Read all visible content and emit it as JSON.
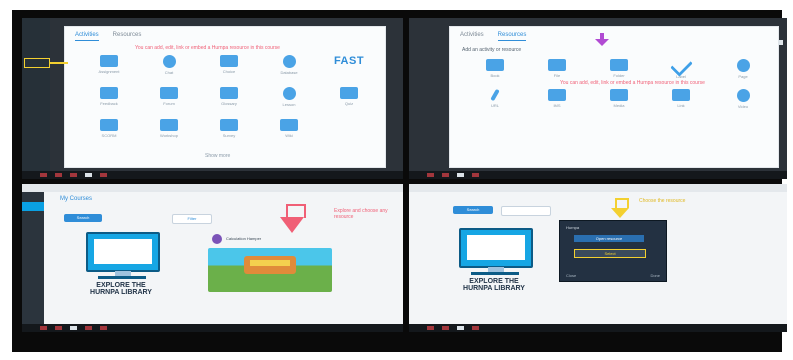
{
  "colors": {
    "accent_blue": "#2f8dd8",
    "hint_pink": "#f05f76",
    "highlight_yellow": "#f3d030",
    "dark_sidebar": "#263038",
    "taskbar_red": "#a2363c"
  },
  "screen1": {
    "tabs": [
      "Activities",
      "Resources"
    ],
    "hint": "You can add, edit, link or embed a Hurnpa resource in this course",
    "tiles": [
      {
        "label": "Assignment",
        "icon": "assignment-icon"
      },
      {
        "label": "Chat",
        "icon": "chat-icon"
      },
      {
        "label": "Choice",
        "icon": "choice-icon"
      },
      {
        "label": "Database",
        "icon": "database-icon"
      },
      {
        "label": "FAST",
        "icon": "fast-logo"
      },
      {
        "label": "Feedback",
        "icon": "feedback-icon"
      },
      {
        "label": "Forum",
        "icon": "forum-icon"
      },
      {
        "label": "Glossary",
        "icon": "glossary-icon"
      },
      {
        "label": "Lesson",
        "icon": "lesson-icon"
      },
      {
        "label": "Quiz",
        "icon": "quiz-icon"
      },
      {
        "label": "SCORM",
        "icon": "scorm-icon"
      },
      {
        "label": "Workshop",
        "icon": "workshop-icon"
      },
      {
        "label": "Survey",
        "icon": "survey-icon"
      },
      {
        "label": "Wiki",
        "icon": "wiki-icon"
      }
    ],
    "footer_link": "Show more"
  },
  "screen2": {
    "tabs": [
      "Activities",
      "Resources"
    ],
    "heading": "Add an activity or resource",
    "hint": "You can add, edit, link or embed a Hurnpa resource in this course",
    "row1": [
      {
        "label": "Book",
        "icon": "book-icon"
      },
      {
        "label": "File",
        "icon": "file-icon"
      },
      {
        "label": "Folder",
        "icon": "folder-icon"
      },
      {
        "label": "Label",
        "icon": "label-check-icon"
      },
      {
        "label": "Page",
        "icon": "page-icon"
      }
    ],
    "row2": [
      {
        "label": "URL",
        "icon": "url-icon"
      },
      {
        "label": "IMS",
        "icon": "ims-icon"
      },
      {
        "label": "Media",
        "icon": "media-icon"
      },
      {
        "label": "Link",
        "icon": "link-icon"
      },
      {
        "label": "Video",
        "icon": "video-icon"
      }
    ]
  },
  "screen3": {
    "title": "My Courses",
    "search_button": "Search",
    "filter_button": "Filter",
    "explore_text": "EXPLORE THE\nHURNPA LIBRARY",
    "course_label": "Calculation Hamper",
    "annotation": "Explore and choose any resource"
  },
  "screen4": {
    "search_button": "Search",
    "explore_text": "EXPLORE THE\nHURNPA LIBRARY",
    "popup_title": "Hurnpa",
    "popup_btn1": "Open resource",
    "popup_btn2": "Select",
    "popup_footer_left": "Close",
    "popup_footer_right": "Done",
    "annotation": "Choose the resource"
  }
}
